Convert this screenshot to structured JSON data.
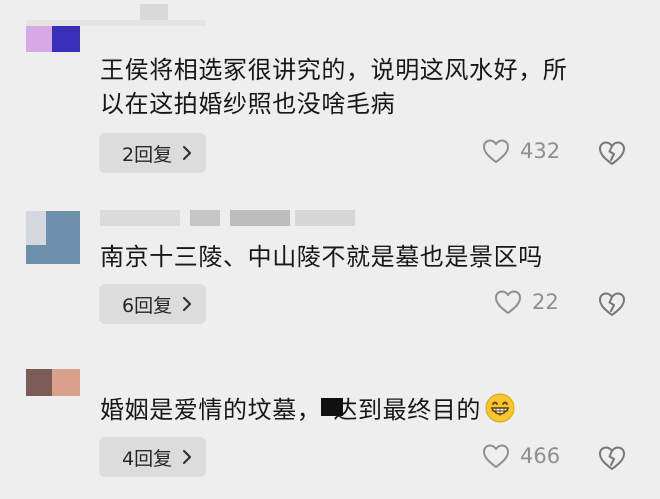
{
  "comments": [
    {
      "text_lines": [
        "王侯将相选冢很讲究的，说明这风水好，所",
        "以在这拍婚纱照也没啥毛病"
      ],
      "reply_label": "2回复",
      "like_count": "432",
      "avatar_colors": [
        "#d7a9e6",
        "#3a2fb8"
      ]
    },
    {
      "text_lines": [
        "南京十三陵、中山陵不就是墓也是景区吗"
      ],
      "reply_label": "6回复",
      "like_count": "22",
      "avatar_colors": [
        "#6c8faa",
        "#d3d8df"
      ]
    },
    {
      "text_before": "婚姻是爱情的坟墓，",
      "text_after": "达到最终目的",
      "reply_label": "4回复",
      "like_count": "466",
      "avatar_colors": [
        "#7a5b55",
        "#d9a08b"
      ]
    }
  ],
  "icons": {
    "reply_chevron": "chevron-right-icon",
    "like": "heart-outline-icon",
    "dislike": "broken-heart-icon",
    "emoji": "grinning-face-emoji"
  },
  "colors": {
    "background": "#eeeeee",
    "button_background": "#dcdcdc",
    "secondary_text": "#8f8f8f"
  }
}
